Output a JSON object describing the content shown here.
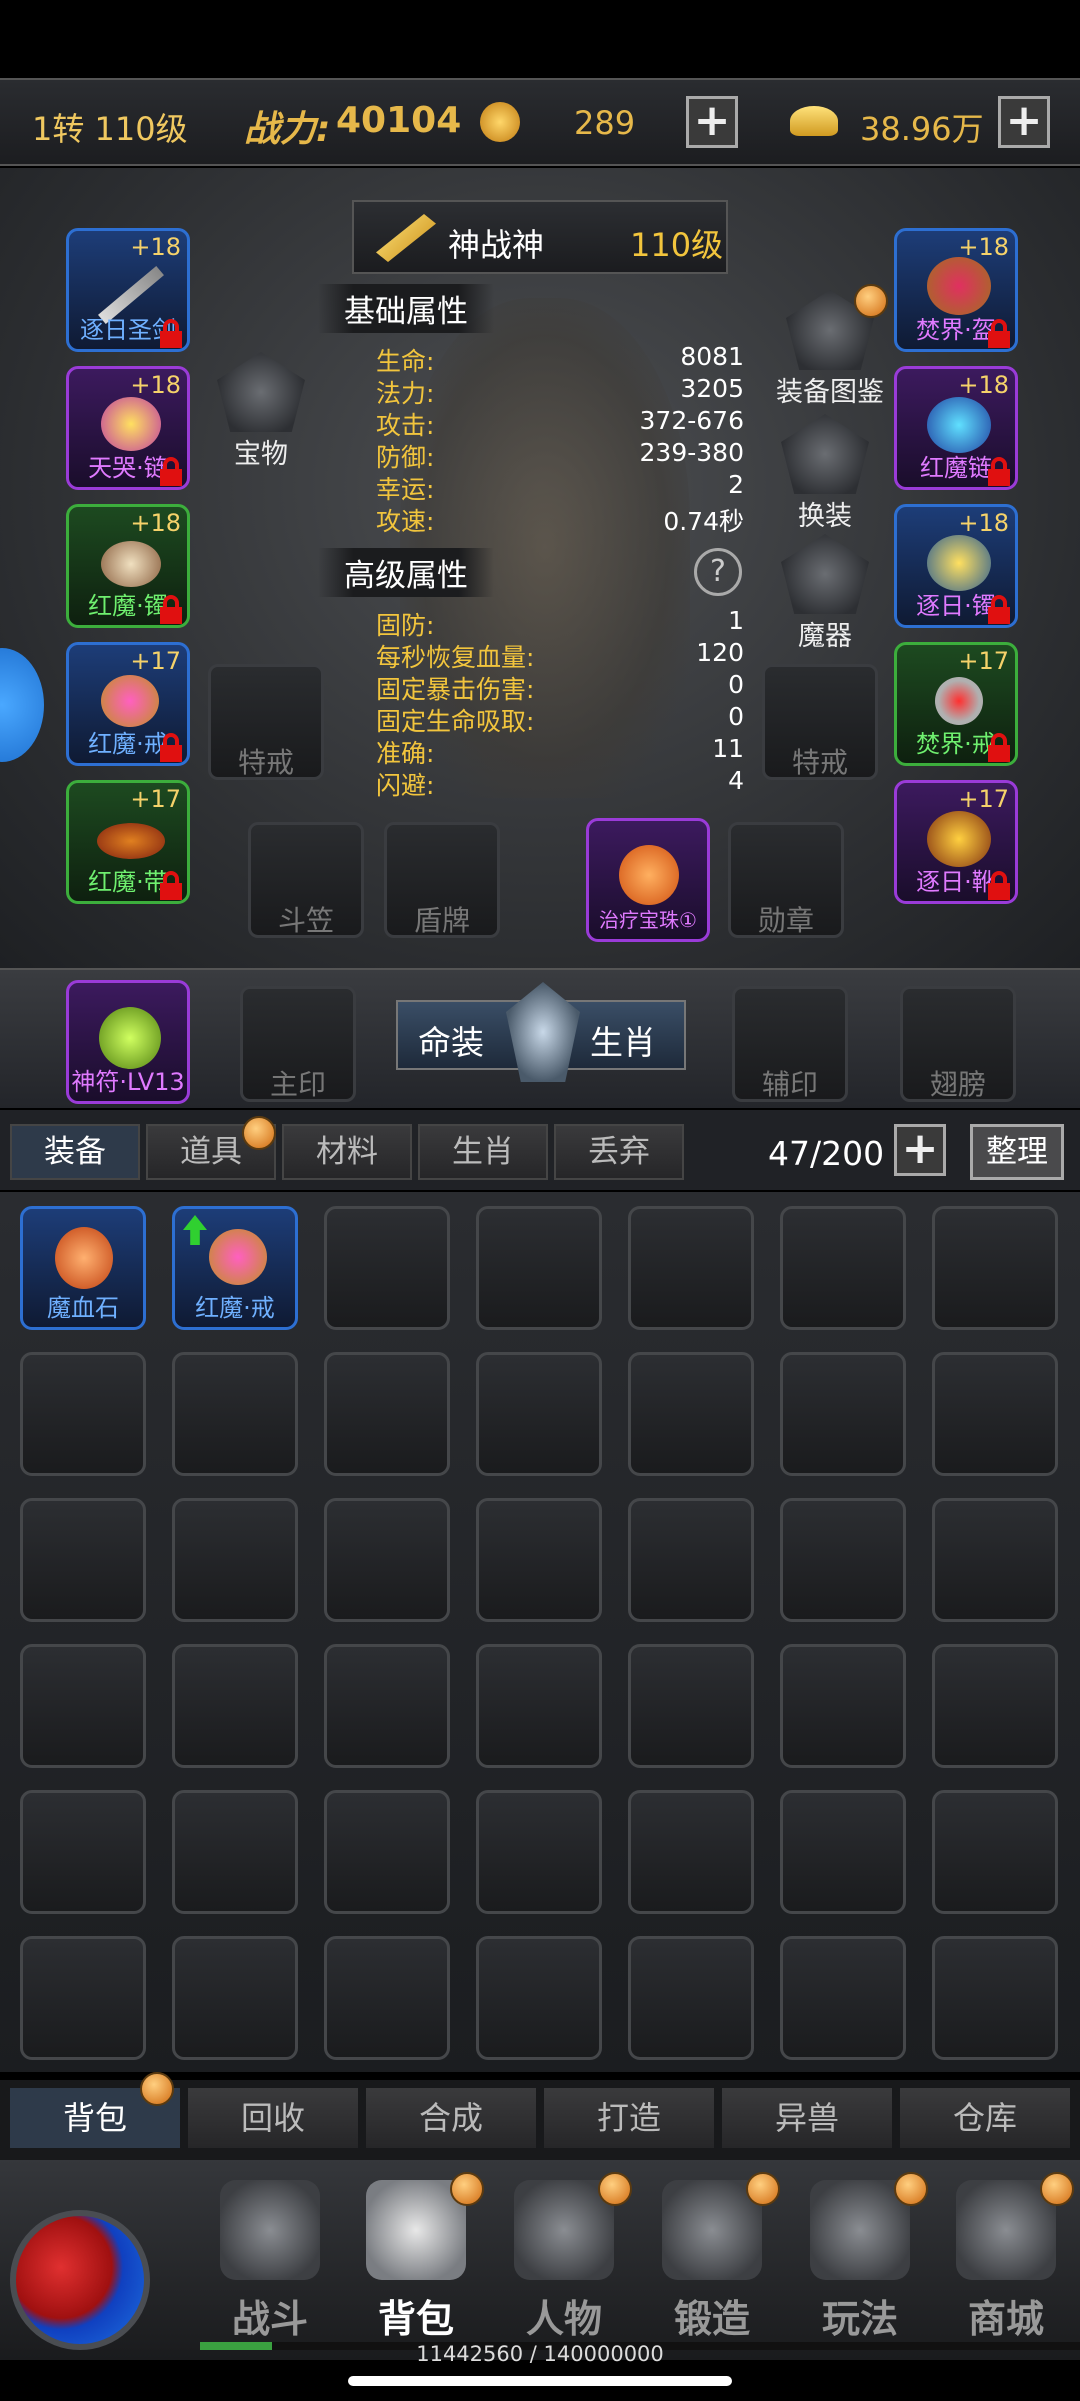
{
  "topbar": {
    "level": "1转 110级",
    "power_label": "战力:",
    "power_value": "40104",
    "currency1": "289",
    "currency2": "38.96万"
  },
  "character": {
    "title": "神战神",
    "level": "110级",
    "basic_title": "基础属性",
    "advanced_title": "高级属性",
    "basic_stats": [
      {
        "label": "生命:",
        "value": "8081"
      },
      {
        "label": "法力:",
        "value": "3205"
      },
      {
        "label": "攻击:",
        "value": "372-676"
      },
      {
        "label": "防御:",
        "value": "239-380"
      },
      {
        "label": "幸运:",
        "value": "2"
      },
      {
        "label": "攻速:",
        "value": "0.74秒"
      }
    ],
    "advanced_stats": [
      {
        "label": "固防:",
        "value": "1"
      },
      {
        "label": "每秒恢复血量:",
        "value": "120"
      },
      {
        "label": "固定暴击伤害:",
        "value": "0"
      },
      {
        "label": "固定生命吸取:",
        "value": "0"
      },
      {
        "label": "准确:",
        "value": "11"
      },
      {
        "label": "闪避:",
        "value": "4"
      }
    ],
    "help": "?"
  },
  "left_slots": [
    {
      "plus": "+18",
      "name": "逐日圣剑",
      "color": "blue"
    },
    {
      "plus": "+18",
      "name": "天哭·链",
      "color": "purple"
    },
    {
      "plus": "+18",
      "name": "红魔·镯",
      "color": "green"
    },
    {
      "plus": "+17",
      "name": "红魔·戒",
      "color": "blue"
    },
    {
      "plus": "+17",
      "name": "红魔·带",
      "color": "green"
    }
  ],
  "right_slots": [
    {
      "plus": "+18",
      "name": "焚界·盔",
      "color": "blue"
    },
    {
      "plus": "+18",
      "name": "红魔链",
      "color": "purple"
    },
    {
      "plus": "+18",
      "name": "逐日·镯",
      "color": "blue"
    },
    {
      "plus": "+17",
      "name": "焚界·戒",
      "color": "green"
    },
    {
      "plus": "+17",
      "name": "逐日·靴",
      "color": "purple"
    }
  ],
  "side_buttons": {
    "treasure": "宝物",
    "codex": "装备图鉴",
    "change": "换装",
    "magic": "魔器"
  },
  "special_slots": {
    "left_ring": "特戒",
    "right_ring": "特戒",
    "hat": "斗笠",
    "shield": "盾牌",
    "gem": "治疗宝珠①",
    "medal": "勋章"
  },
  "midbar": {
    "talisman": "神符·LV13",
    "main_seal": "主印",
    "fate": "命装",
    "zodiac": "生肖",
    "aux_seal": "辅印",
    "wings": "翅膀"
  },
  "inventory_tabs": [
    "装备",
    "道具",
    "材料",
    "生肖",
    "丢弃"
  ],
  "inventory": {
    "count": "47/200",
    "sort": "整理",
    "items": [
      {
        "name": "魔血石"
      },
      {
        "name": "红魔·戒"
      }
    ]
  },
  "sub_tabs": [
    "背包",
    "回收",
    "合成",
    "打造",
    "异兽",
    "仓库"
  ],
  "bottom_nav": [
    "战斗",
    "背包",
    "人物",
    "锻造",
    "玩法",
    "商城"
  ],
  "exp_text": "11442560 / 140000000"
}
